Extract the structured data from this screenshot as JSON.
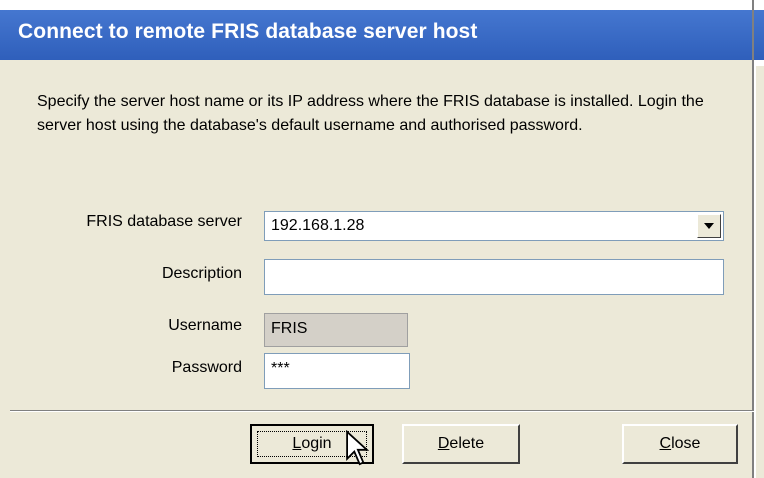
{
  "window": {
    "title": "Connect to remote FRIS database server host"
  },
  "description": "Specify the server host name or its IP address where the FRIS database is installed. Login the server host using the database's default username and authorised password.",
  "form": {
    "server_label": "FRIS database server",
    "server_value": "192.168.1.28",
    "description_label": "Description",
    "description_value": "",
    "username_label": "Username",
    "username_value": "FRIS",
    "password_label": "Password",
    "password_value": "***"
  },
  "buttons": {
    "login": {
      "rest": "ogin",
      "accel": "L"
    },
    "delete": {
      "rest": "elete",
      "accel": "D"
    },
    "close": {
      "rest": "lose",
      "accel": "C"
    }
  }
}
